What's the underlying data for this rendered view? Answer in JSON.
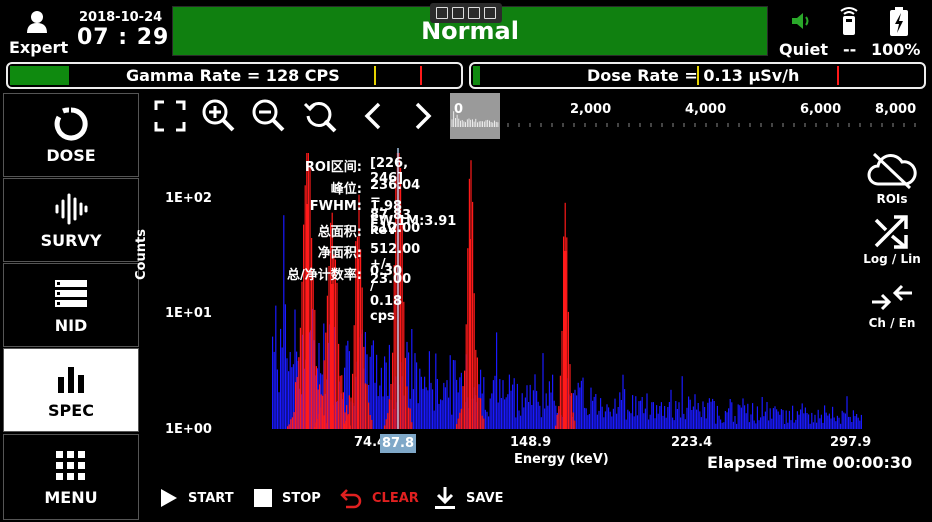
{
  "header": {
    "user_label": "Expert",
    "date": "2018-10-24",
    "time": "07 : 29",
    "status": "Normal",
    "sound_label": "Quiet",
    "signal_label": "--",
    "battery_label": "100%"
  },
  "rate_bars": {
    "gamma": {
      "label": "Gamma Rate = 128 CPS",
      "fill_fraction": 0.13
    },
    "dose": {
      "label": "Dose Rate = ",
      "value": "0.13 μSv/h",
      "fill_fraction": 0.015
    }
  },
  "nav": [
    {
      "label": "DOSE",
      "icon": "dose-icon"
    },
    {
      "label": "SURVY",
      "icon": "survey-icon"
    },
    {
      "label": "NID",
      "icon": "nid-icon"
    },
    {
      "label": "SPEC",
      "icon": "spec-icon",
      "active": true
    },
    {
      "label": "MENU",
      "icon": "menu-grid-icon"
    }
  ],
  "toolbar_icons": [
    "fullscreen-icon",
    "zoom-in-icon",
    "zoom-out-icon",
    "zoom-reset-icon",
    "chevron-left-icon",
    "chevron-right-icon"
  ],
  "overview_axis": [
    "0",
    "2,000",
    "4,000",
    "6,000",
    "8,000"
  ],
  "right_tools": [
    {
      "label": "ROIs",
      "icon": "cloud-off-icon"
    },
    {
      "label": "Log / Lin",
      "icon": "shuffle-icon"
    },
    {
      "label": "Ch / En",
      "icon": "compress-arrows-icon"
    }
  ],
  "roi_info": [
    {
      "key": "ROI区间:",
      "value": "[226, 246]"
    },
    {
      "key": "峰位:",
      "value": "236.04 = 87.83 keV"
    },
    {
      "key": "FWHM:",
      "value": "1.98 FW.1M:3.91"
    },
    {
      "key": "总面积:",
      "value": "512.00"
    },
    {
      "key": "净面积:",
      "value": "512.00 +/- 23.00"
    },
    {
      "key": "总/净计数率:",
      "value": "0.30 / 0.18 cps"
    }
  ],
  "plot": {
    "y_ticks": [
      "1E+02",
      "1E+01",
      "1E+00"
    ],
    "x_ticks": [
      "74.4",
      "148.9",
      "223.4",
      "297.9"
    ],
    "cursor_value": "87.8",
    "ylabel": "Counts",
    "xlabel": "Energy (keV)"
  },
  "elapsed": "Elapsed Time 00:00:30",
  "actions": [
    {
      "label": "START",
      "icon": "play-icon"
    },
    {
      "label": "STOP",
      "icon": "stop-icon"
    },
    {
      "label": "CLEAR",
      "icon": "undo-icon",
      "color": "#e02020"
    },
    {
      "label": "SAVE",
      "icon": "download-icon"
    }
  ],
  "colors": {
    "ok_green": "#108010",
    "roi_red": "#ff1a1a",
    "spectrum_blue": "#1a1aff",
    "warn_yellow": "#e6d200"
  }
}
